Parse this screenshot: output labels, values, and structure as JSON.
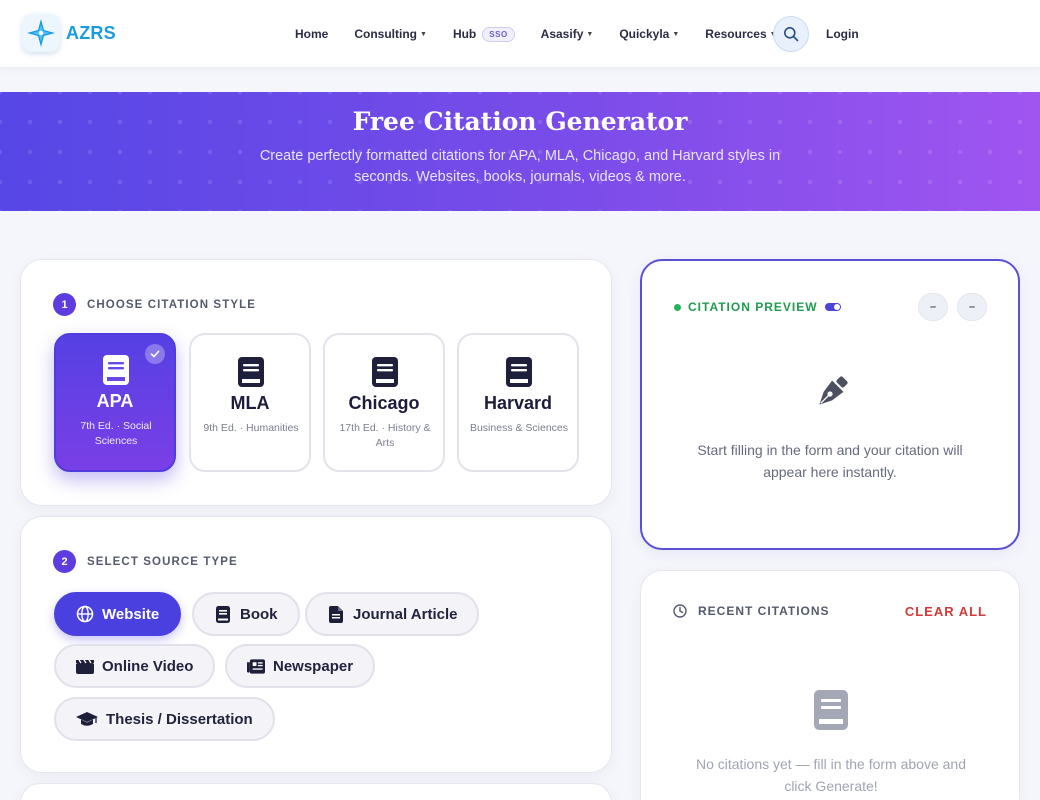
{
  "nav": {
    "brand": "AZRS",
    "links": [
      {
        "label": "Home",
        "dropdown": false
      },
      {
        "label": "Consulting",
        "dropdown": true
      },
      {
        "label": "Hub",
        "badge": "SSO",
        "dropdown": false
      },
      {
        "label": "Asasify",
        "dropdown": true
      },
      {
        "label": "Quickyla",
        "dropdown": true
      },
      {
        "label": "Resources",
        "dropdown": true
      }
    ],
    "search_icon": "search-icon",
    "login": "Login"
  },
  "hero": {
    "title": "Free Citation Generator",
    "subtitle": "Create perfectly formatted citations for APA, MLA, Chicago, and Harvard styles in seconds. Websites, books, journals, videos & more."
  },
  "style_section": {
    "step": "1",
    "label": "CHOOSE CITATION STYLE",
    "styles": [
      {
        "name": "APA",
        "desc": "7th Ed. · Social Sciences",
        "selected": true
      },
      {
        "name": "MLA",
        "desc": "9th Ed. · Humanities",
        "selected": false
      },
      {
        "name": "Chicago",
        "desc": "17th Ed. · History & Arts",
        "selected": false
      },
      {
        "name": "Harvard",
        "desc": "Business & Sciences",
        "selected": false
      }
    ]
  },
  "source_section": {
    "step": "2",
    "label": "SELECT SOURCE TYPE",
    "sources": [
      {
        "label": "Website",
        "icon": "globe-icon",
        "selected": true
      },
      {
        "label": "Book",
        "icon": "book-icon",
        "selected": false
      },
      {
        "label": "Journal Article",
        "icon": "document-icon",
        "selected": false
      },
      {
        "label": "Online Video",
        "icon": "clapperboard-icon",
        "selected": false
      },
      {
        "label": "Newspaper",
        "icon": "newspaper-icon",
        "selected": false
      },
      {
        "label": "Thesis / Dissertation",
        "icon": "graduation-cap-icon",
        "selected": false
      }
    ]
  },
  "preview": {
    "label": "CITATION PREVIEW",
    "btn1": "–",
    "btn2": "–",
    "empty_text": "Start filling in the form and your citation will appear here instantly."
  },
  "recent": {
    "label": "RECENT CITATIONS",
    "clear_all": "CLEAR ALL",
    "empty_text": "No citations yet — fill in the form above and click Generate!"
  },
  "colors": {
    "accent": "#4a40df",
    "hero_start": "#5647e6",
    "hero_end": "#a055f0",
    "success": "#1f9c4d",
    "danger": "#d43a3a"
  }
}
